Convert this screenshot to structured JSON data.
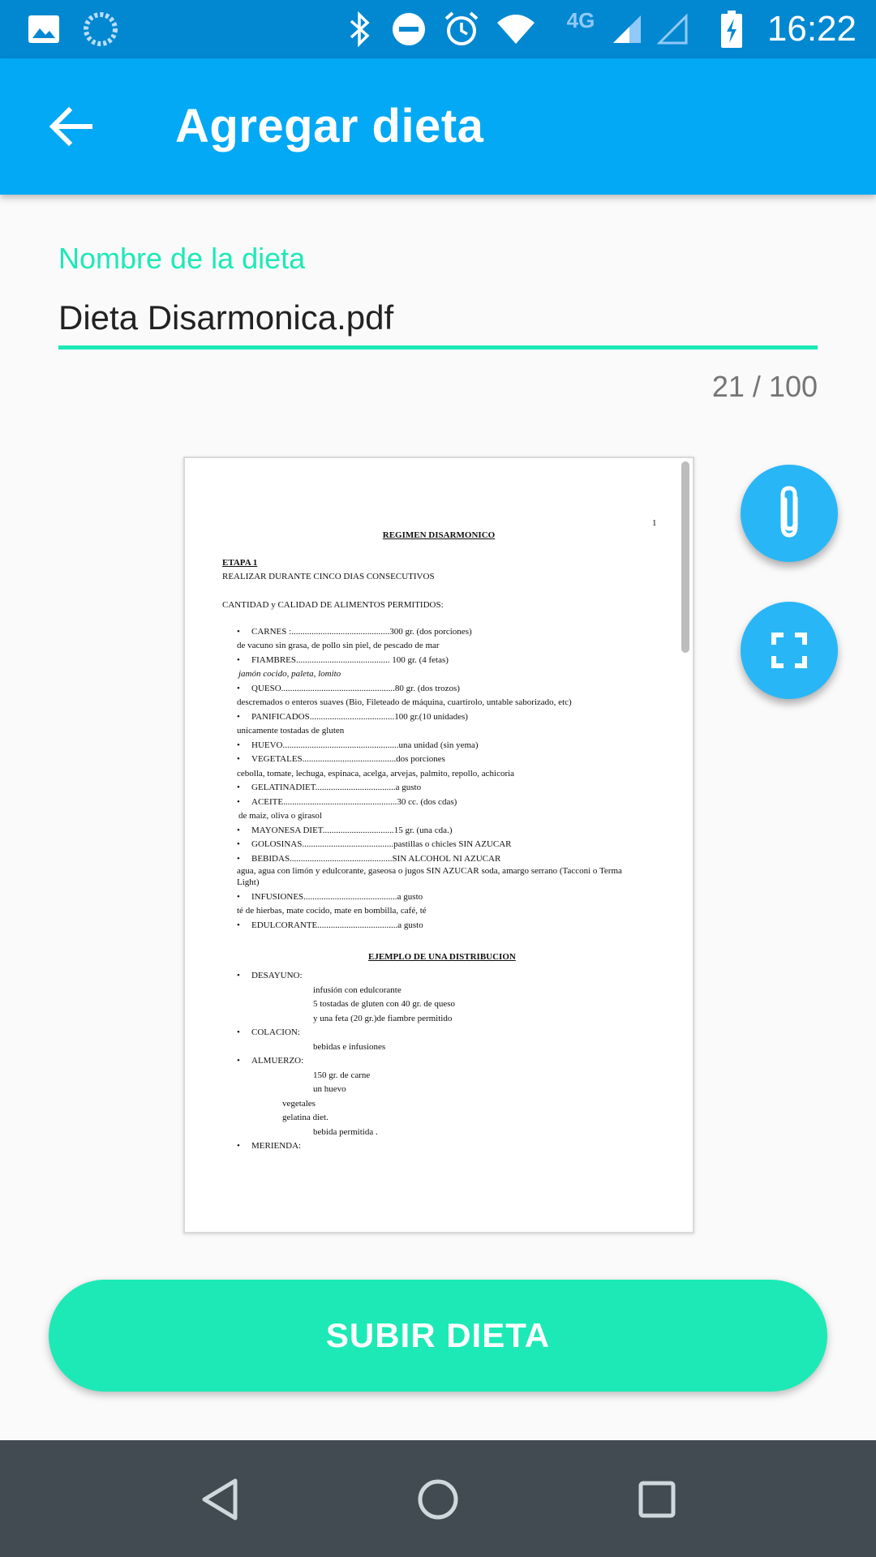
{
  "status_bar": {
    "time": "16:22",
    "network": "4G",
    "icons": [
      "image-icon",
      "sync-icon",
      "bluetooth-icon",
      "do-not-disturb-icon",
      "alarm-icon",
      "wifi-icon",
      "signal-icon",
      "signal-empty-icon",
      "battery-charging-icon"
    ]
  },
  "app_bar": {
    "title": "Agregar dieta",
    "back_icon": "arrow-back-icon"
  },
  "form": {
    "label": "Nombre de la dieta",
    "value": "Dieta Disarmonica.pdf",
    "counter": "21 / 100"
  },
  "pdf": {
    "page_number": "1",
    "title": "REGIMEN DISARMONICO",
    "stage": "ETAPA 1",
    "lines": [
      "REALIZAR DURANTE CINCO DIAS CONSECUTIVOS",
      "CANTIDAD y CALIDAD DE ALIMENTOS PERMITIDOS:",
      "CARNES :............................................300 gr. (dos porciones)",
      "de vacuno sin grasa, de pollo sin piel, de pescado de mar",
      "FIAMBRES.......................................... 100 gr. (4 fetas)",
      "jamón cocido, paleta, lomito",
      "QUESO...................................................80 gr. (dos trozos)",
      "descremados o enteros suaves (Bio, Fileteado de máquina, cuartirolo, untable saborizado, etc)",
      "PANIFICADOS......................................100 gr.(10 unidades)",
      "unicamente tostadas de gluten",
      "HUEVO....................................................una unidad (sin yema)",
      "VEGETALES..........................................dos porciones",
      "cebolla, tomate, lechuga, espinaca, acelga, arvejas, palmito, repollo, achicoria",
      "GELATINADIET....................................a gusto",
      "ACEITE...................................................30 cc. (dos cdas)",
      "de maiz, oliva o girasol",
      "MAYONESA DIET................................15 gr. (una cda.)",
      "GOLOSINAS.........................................pastillas o chicles SIN AZUCAR",
      "BEBIDAS..............................................SIN ALCOHOL NI AZUCAR",
      "agua, agua con limón y edulcorante, gaseosa o jugos SIN AZUCAR soda, amargo serrano (Tacconi o Terma",
      "Light)",
      "INFUSIONES..........................................a gusto",
      "té de hierbas, mate cocido, mate en bombilla, café, té",
      "EDULCORANTE....................................a gusto",
      "EJEMPLO DE UNA DISTRIBUCION",
      "DESAYUNO:",
      "infusión con edulcorante",
      "5 tostadas de gluten con 40 gr. de queso",
      "y una feta (20 gr.)de fiambre permitido",
      "COLACION:",
      "bebidas e infusiones",
      "ALMUERZO:",
      "150 gr. de carne",
      "un huevo",
      "vegetales",
      "gelatina diet.",
      "bebida permitida .",
      "MERIENDA:"
    ]
  },
  "fabs": {
    "attach_icon": "paperclip-icon",
    "fullscreen_icon": "fullscreen-icon"
  },
  "upload_button": "SUBIR DIETA",
  "nav_bar": {
    "icons": [
      "back-triangle-icon",
      "home-circle-icon",
      "recents-square-icon"
    ]
  },
  "colors": {
    "status_bar": "#0288d1",
    "app_bar": "#03a9f4",
    "accent": "#1de9b6",
    "fab": "#29b6f6",
    "nav_bar": "#424a52"
  }
}
